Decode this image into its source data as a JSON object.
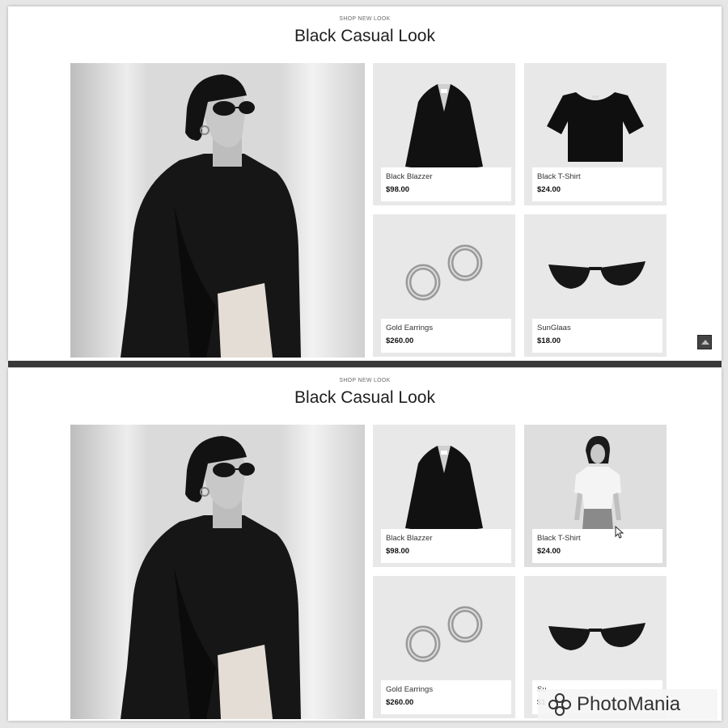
{
  "colors": {
    "page_bg": "#ffffff",
    "card_bg": "#e8e8e8",
    "text": "#222222",
    "watermark_text": "#333333"
  },
  "screens": [
    {
      "eyebrow": "SHOP NEW LOOK",
      "title": "Black Casual Look",
      "products": [
        {
          "name": "Black Blazzer",
          "price": "$98.00",
          "icon": "blazer"
        },
        {
          "name": "Black T-Shirt",
          "price": "$24.00",
          "icon": "tshirt"
        },
        {
          "name": "Gold Earrings",
          "price": "$260.00",
          "icon": "earrings"
        },
        {
          "name": "SunGlaas",
          "price": "$18.00",
          "icon": "sunglasses"
        }
      ],
      "scroll_top_icon": "arrow-up-icon"
    },
    {
      "eyebrow": "SHOP NEW LOOK",
      "title": "Black Casual Look",
      "products": [
        {
          "name": "Black Blazzer",
          "price": "$98.00",
          "icon": "blazer"
        },
        {
          "name": "Black T-Shirt",
          "price": "$24.00",
          "icon": "model-in-tshirt"
        },
        {
          "name": "Gold Earrings",
          "price": "$260.00",
          "icon": "earrings"
        },
        {
          "name": "Su",
          "price": "$1",
          "icon": "sunglasses"
        }
      ]
    }
  ],
  "watermark": {
    "text": "PhotoMania",
    "icon": "photomania-logo-icon"
  }
}
